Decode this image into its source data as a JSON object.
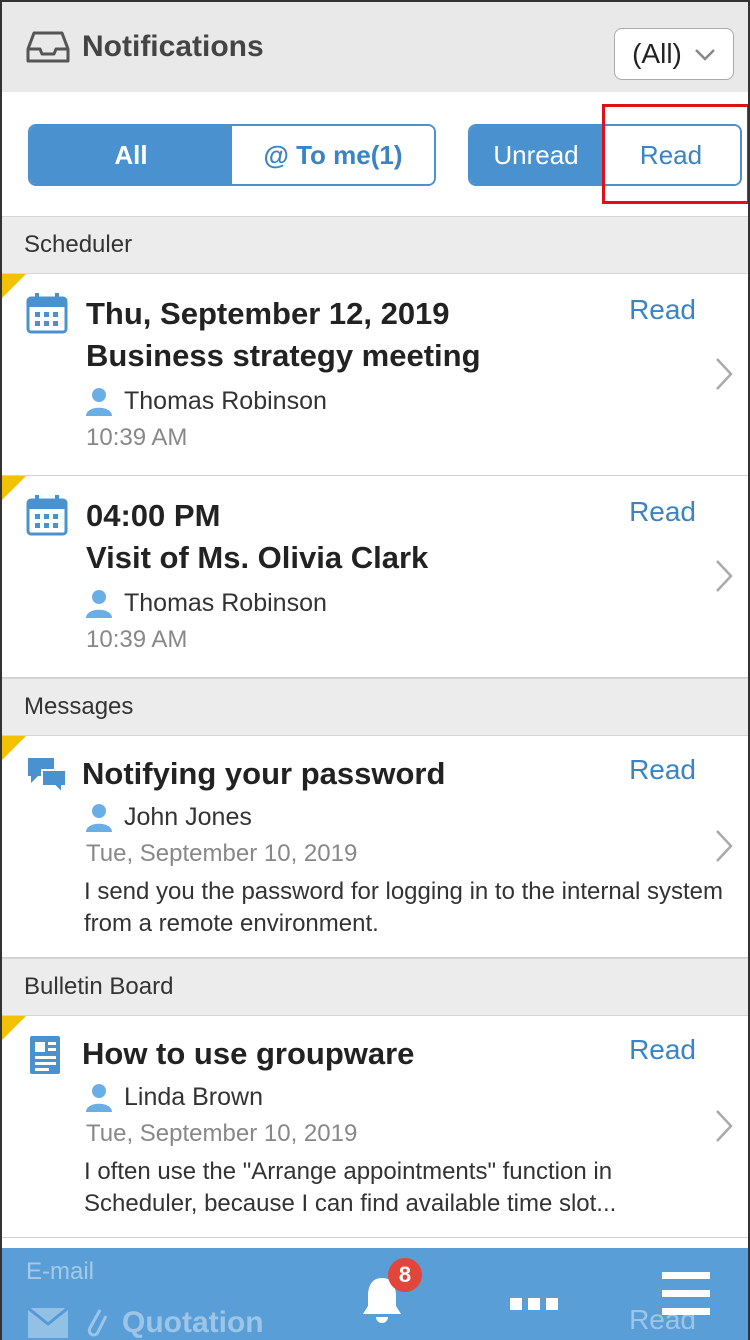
{
  "header": {
    "title": "Notifications",
    "filter_value": "(All)"
  },
  "toolbar": {
    "scope_tabs": [
      {
        "label": "All",
        "selected": true
      },
      {
        "label": "@ To me(1)",
        "selected": false
      }
    ],
    "state_tabs": [
      {
        "label": "Unread",
        "selected": true
      },
      {
        "label": "Read",
        "selected": false
      }
    ]
  },
  "sections": [
    {
      "label": "Scheduler"
    },
    {
      "label": "Messages"
    },
    {
      "label": "Bulletin Board"
    },
    {
      "label": "E-mail"
    }
  ],
  "items": [
    {
      "icon": "calendar-icon",
      "line1": "Thu, September 12, 2019",
      "line2": "Business strategy meeting",
      "user": "Thomas Robinson",
      "time": "10:39 AM",
      "action": "Read"
    },
    {
      "icon": "calendar-icon",
      "line1": "04:00 PM",
      "line2": "Visit of Ms. Olivia Clark",
      "user": "Thomas Robinson",
      "time": "10:39 AM",
      "action": "Read"
    },
    {
      "icon": "chat-bubbles-icon",
      "line1": "Notifying your password",
      "user": "John Jones",
      "time": "Tue, September 10, 2019",
      "body": "I send you the password for logging in to the internal system from a remote environment.",
      "action": "Read"
    },
    {
      "icon": "bulletin-board-icon",
      "line1": "How to use groupware",
      "user": "Linda Brown",
      "time": "Tue, September 10, 2019",
      "body": "I often use the \"Arrange appointments\" function in Scheduler, because I can find available time slot...",
      "action": "Read"
    },
    {
      "icon": "envelope-icon",
      "line1": "Quotation",
      "action": "Read"
    }
  ],
  "bottom_nav": {
    "notification_count": "8",
    "icons": [
      "bell-icon",
      "more-dots-icon",
      "hamburger-menu-icon"
    ]
  },
  "colors": {
    "accent": "#4a92cf",
    "link": "#3a84c4",
    "unread_marker": "#f2c200",
    "badge": "#e2463a",
    "highlight": "#e0101a"
  }
}
